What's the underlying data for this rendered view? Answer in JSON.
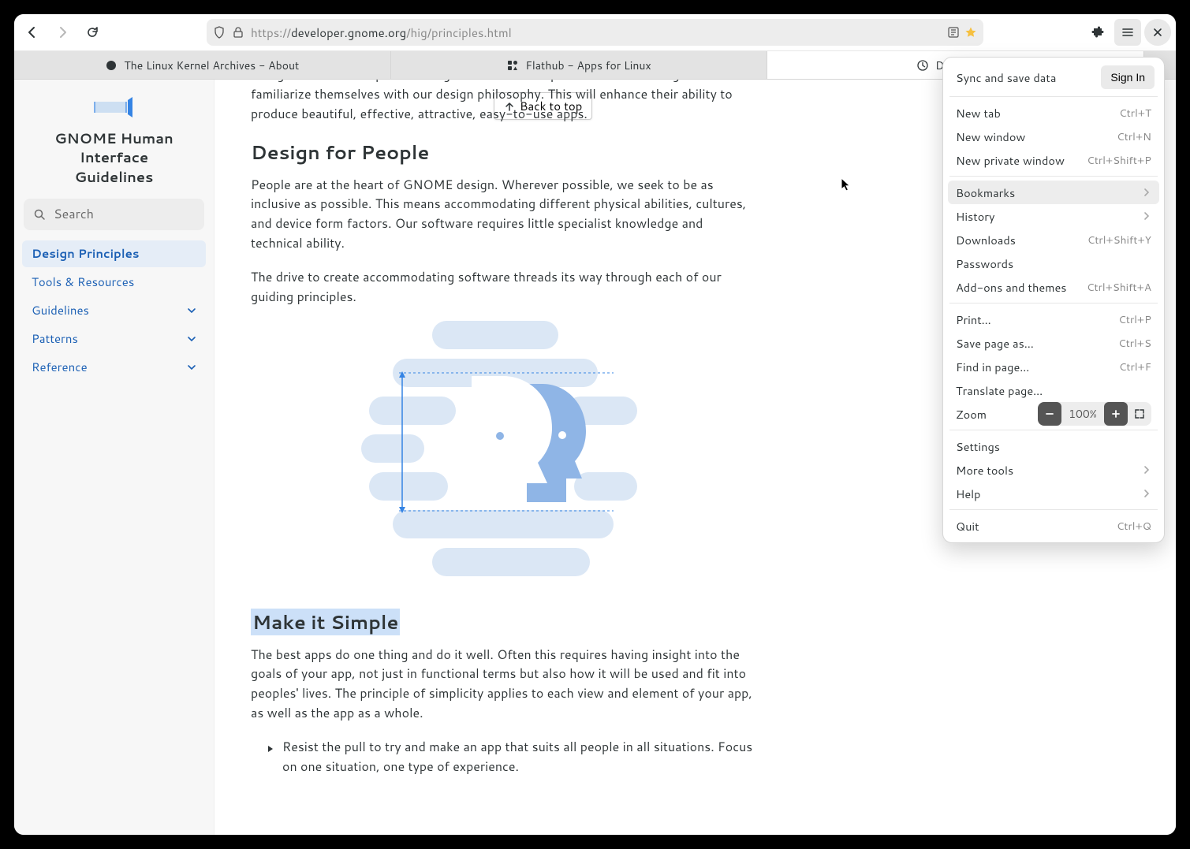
{
  "url_display_prefix": "https://",
  "url_host": "developer.gnome.org",
  "url_path": "/hig/principles.html",
  "tabs": [
    {
      "label": "The Linux Kernel Archives - About"
    },
    {
      "label": "Flathub - Apps for Linux"
    },
    {
      "label": "Design Prin"
    }
  ],
  "back_to_top": "Back to top",
  "sidebar": {
    "title_line1": "GNOME Human Interface",
    "title_line2": "Guidelines",
    "search_placeholder": "Search",
    "items": [
      {
        "label": "Design Principles",
        "active": true,
        "expandable": false
      },
      {
        "label": "Tools & Resources",
        "active": false,
        "expandable": false
      },
      {
        "label": "Guidelines",
        "active": false,
        "expandable": true
      },
      {
        "label": "Patterns",
        "active": false,
        "expandable": true
      },
      {
        "label": "Reference",
        "active": false,
        "expandable": true
      }
    ]
  },
  "page": {
    "intro_fragment": "familiarize themselves with our design philosophy. This will enhance their ability to produce beautiful, effective, attractive, easy-to-use apps.",
    "intro_prefix": "Designers and developers building for the GNOME platform are encouraged to",
    "h_people": "Design for People",
    "p_people_1": "People are at the heart of GNOME design. Wherever possible, we seek to be as inclusive as possible. This means accommodating different physical abilities, cultures, and device form factors. Our software requires little specialist knowledge and technical ability.",
    "p_people_2": "The drive to create accommodating software threads its way through each of our guiding principles.",
    "h_simple": "Make it Simple",
    "p_simple_1": "The best apps do one thing and do it well. Often this requires having insight into the goals of your app, not just in functional terms but also how it will be used and fit into peoples' lives. The principle of simplicity applies to each view and element of your app, as well as the app as a whole.",
    "bullet_1": "Resist the pull to try and make an app that suits all people in all situations. Focus on one situation, one type of experience."
  },
  "menu": {
    "sync_label": "Sync and save data",
    "sign_in": "Sign In",
    "items1": [
      {
        "label": "New tab",
        "hint": "Ctrl+T"
      },
      {
        "label": "New window",
        "hint": "Ctrl+N"
      },
      {
        "label": "New private window",
        "hint": "Ctrl+Shift+P"
      }
    ],
    "items2": [
      {
        "label": "Bookmarks",
        "arrow": true,
        "hover": true
      },
      {
        "label": "History",
        "arrow": true
      },
      {
        "label": "Downloads",
        "hint": "Ctrl+Shift+Y"
      },
      {
        "label": "Passwords"
      },
      {
        "label": "Add-ons and themes",
        "hint": "Ctrl+Shift+A"
      }
    ],
    "items3": [
      {
        "label": "Print…",
        "hint": "Ctrl+P"
      },
      {
        "label": "Save page as…",
        "hint": "Ctrl+S"
      },
      {
        "label": "Find in page…",
        "hint": "Ctrl+F"
      },
      {
        "label": "Translate page…"
      }
    ],
    "zoom_label": "Zoom",
    "zoom_value": "100%",
    "items4": [
      {
        "label": "Settings"
      },
      {
        "label": "More tools",
        "arrow": true
      },
      {
        "label": "Help",
        "arrow": true
      }
    ],
    "quit": {
      "label": "Quit",
      "hint": "Ctrl+Q"
    }
  }
}
